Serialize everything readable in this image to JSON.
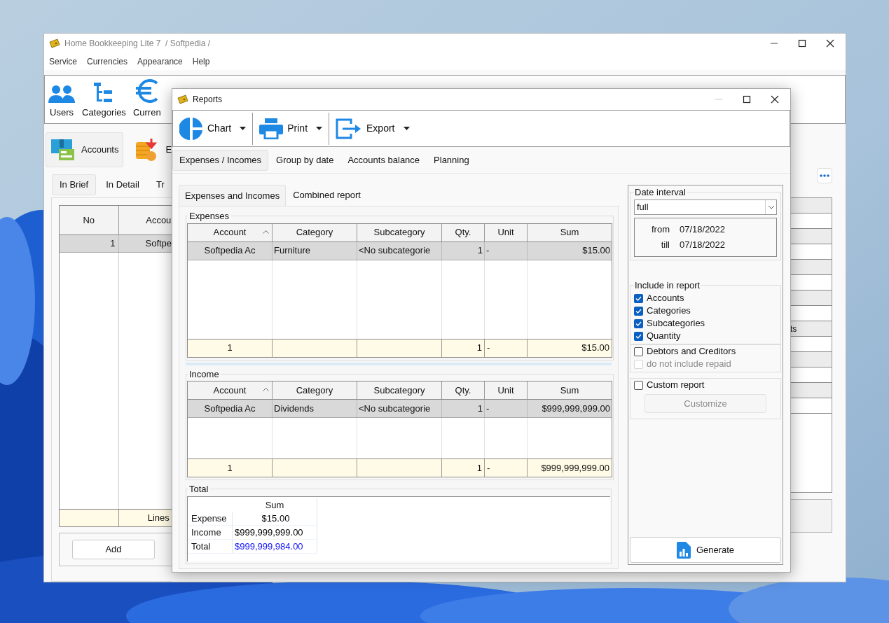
{
  "main_window": {
    "title": "Home Bookkeeping Lite 7  / Softpedia /",
    "menu": [
      "Service",
      "Currencies",
      "Appearance",
      "Help"
    ],
    "toolbar": [
      {
        "label": "Users"
      },
      {
        "label": "Categories"
      },
      {
        "label": "Curren"
      }
    ],
    "sections": [
      {
        "label": "Accounts",
        "selected": true
      },
      {
        "label": "E",
        "selected": false
      }
    ],
    "tabs": [
      {
        "label": "In Brief",
        "selected": true
      },
      {
        "label": "In Detail",
        "selected": false
      },
      {
        "label": "Tr",
        "selected": false
      }
    ],
    "table": {
      "columns": [
        "No",
        "Accou"
      ],
      "rows": [
        {
          "cells": [
            "1",
            "Softpe"
          ],
          "selected": true
        }
      ],
      "footer": {
        "column_2": "Lines"
      }
    },
    "side_table": {
      "cell": "ts"
    },
    "add_button": "Add"
  },
  "reports": {
    "title": "Reports",
    "toolbar": [
      {
        "label": "Chart"
      },
      {
        "label": "Print"
      },
      {
        "label": "Export"
      }
    ],
    "tabs": [
      {
        "label": "Expenses / Incomes",
        "selected": true
      },
      {
        "label": "Group by date",
        "selected": false
      },
      {
        "label": "Accounts balance",
        "selected": false
      },
      {
        "label": "Planning",
        "selected": false
      }
    ],
    "subtabs": [
      {
        "label": "Expenses and Incomes",
        "selected": true
      },
      {
        "label": "Combined report",
        "selected": false
      }
    ],
    "expenses": {
      "title": "Expenses",
      "columns": [
        {
          "label": "Account",
          "sorted": true
        },
        {
          "label": "Category",
          "sorted": false
        },
        {
          "label": "Subcategory",
          "sorted": false
        },
        {
          "label": "Qty.",
          "sorted": false
        },
        {
          "label": "Unit",
          "sorted": false
        },
        {
          "label": "Sum",
          "sorted": false
        }
      ],
      "rows": [
        {
          "cells": [
            "Softpedia Ac",
            "Furniture",
            "<No subcategorie",
            "1",
            "-",
            "$15.00"
          ],
          "selected": true
        }
      ],
      "footer": {
        "account": "1",
        "qty": "1",
        "unit": "-",
        "sum": "$15.00"
      }
    },
    "income": {
      "title": "Income",
      "columns": [
        {
          "label": "Account",
          "sorted": true
        },
        {
          "label": "Category",
          "sorted": false
        },
        {
          "label": "Subcategory",
          "sorted": false
        },
        {
          "label": "Qty.",
          "sorted": false
        },
        {
          "label": "Unit",
          "sorted": false
        },
        {
          "label": "Sum",
          "sorted": false
        }
      ],
      "rows": [
        {
          "cells": [
            "Softpedia Ac",
            "Dividends",
            "<No subcategorie",
            "1",
            "-",
            "$999,999,999.00"
          ],
          "selected": true
        }
      ],
      "footer": {
        "account": "1",
        "qty": "1",
        "unit": "-",
        "sum": "$999,999,999.00"
      }
    },
    "total": {
      "title": "Total",
      "column": "Sum",
      "rows": [
        {
          "label": "Expense",
          "value": "$15.00",
          "kind": "normal"
        },
        {
          "label": "Income",
          "value": "$999,999,999.00",
          "kind": "normal"
        },
        {
          "label": "Total",
          "value": "$999,999,984.00",
          "kind": "result"
        }
      ]
    },
    "date_interval": {
      "title": "Date interval",
      "value": "full",
      "from_label": "from",
      "from": "07/18/2022",
      "till_label": "till",
      "till": "07/18/2022"
    },
    "include": {
      "title": "Include in report",
      "options": [
        {
          "label": "Accounts",
          "checked": true
        },
        {
          "label": "Categories",
          "checked": true
        },
        {
          "label": "Subcategories",
          "checked": true
        },
        {
          "label": "Quantity",
          "checked": true
        }
      ]
    },
    "debtors": {
      "label": "Debtors and Creditors",
      "checked": false
    },
    "repaid": {
      "label": "do not include repaid",
      "checked": false,
      "disabled": true
    },
    "custom_report": {
      "label": "Custom report",
      "checked": false
    },
    "customize": {
      "label": "Customize",
      "disabled": true
    },
    "generate": "Generate"
  }
}
